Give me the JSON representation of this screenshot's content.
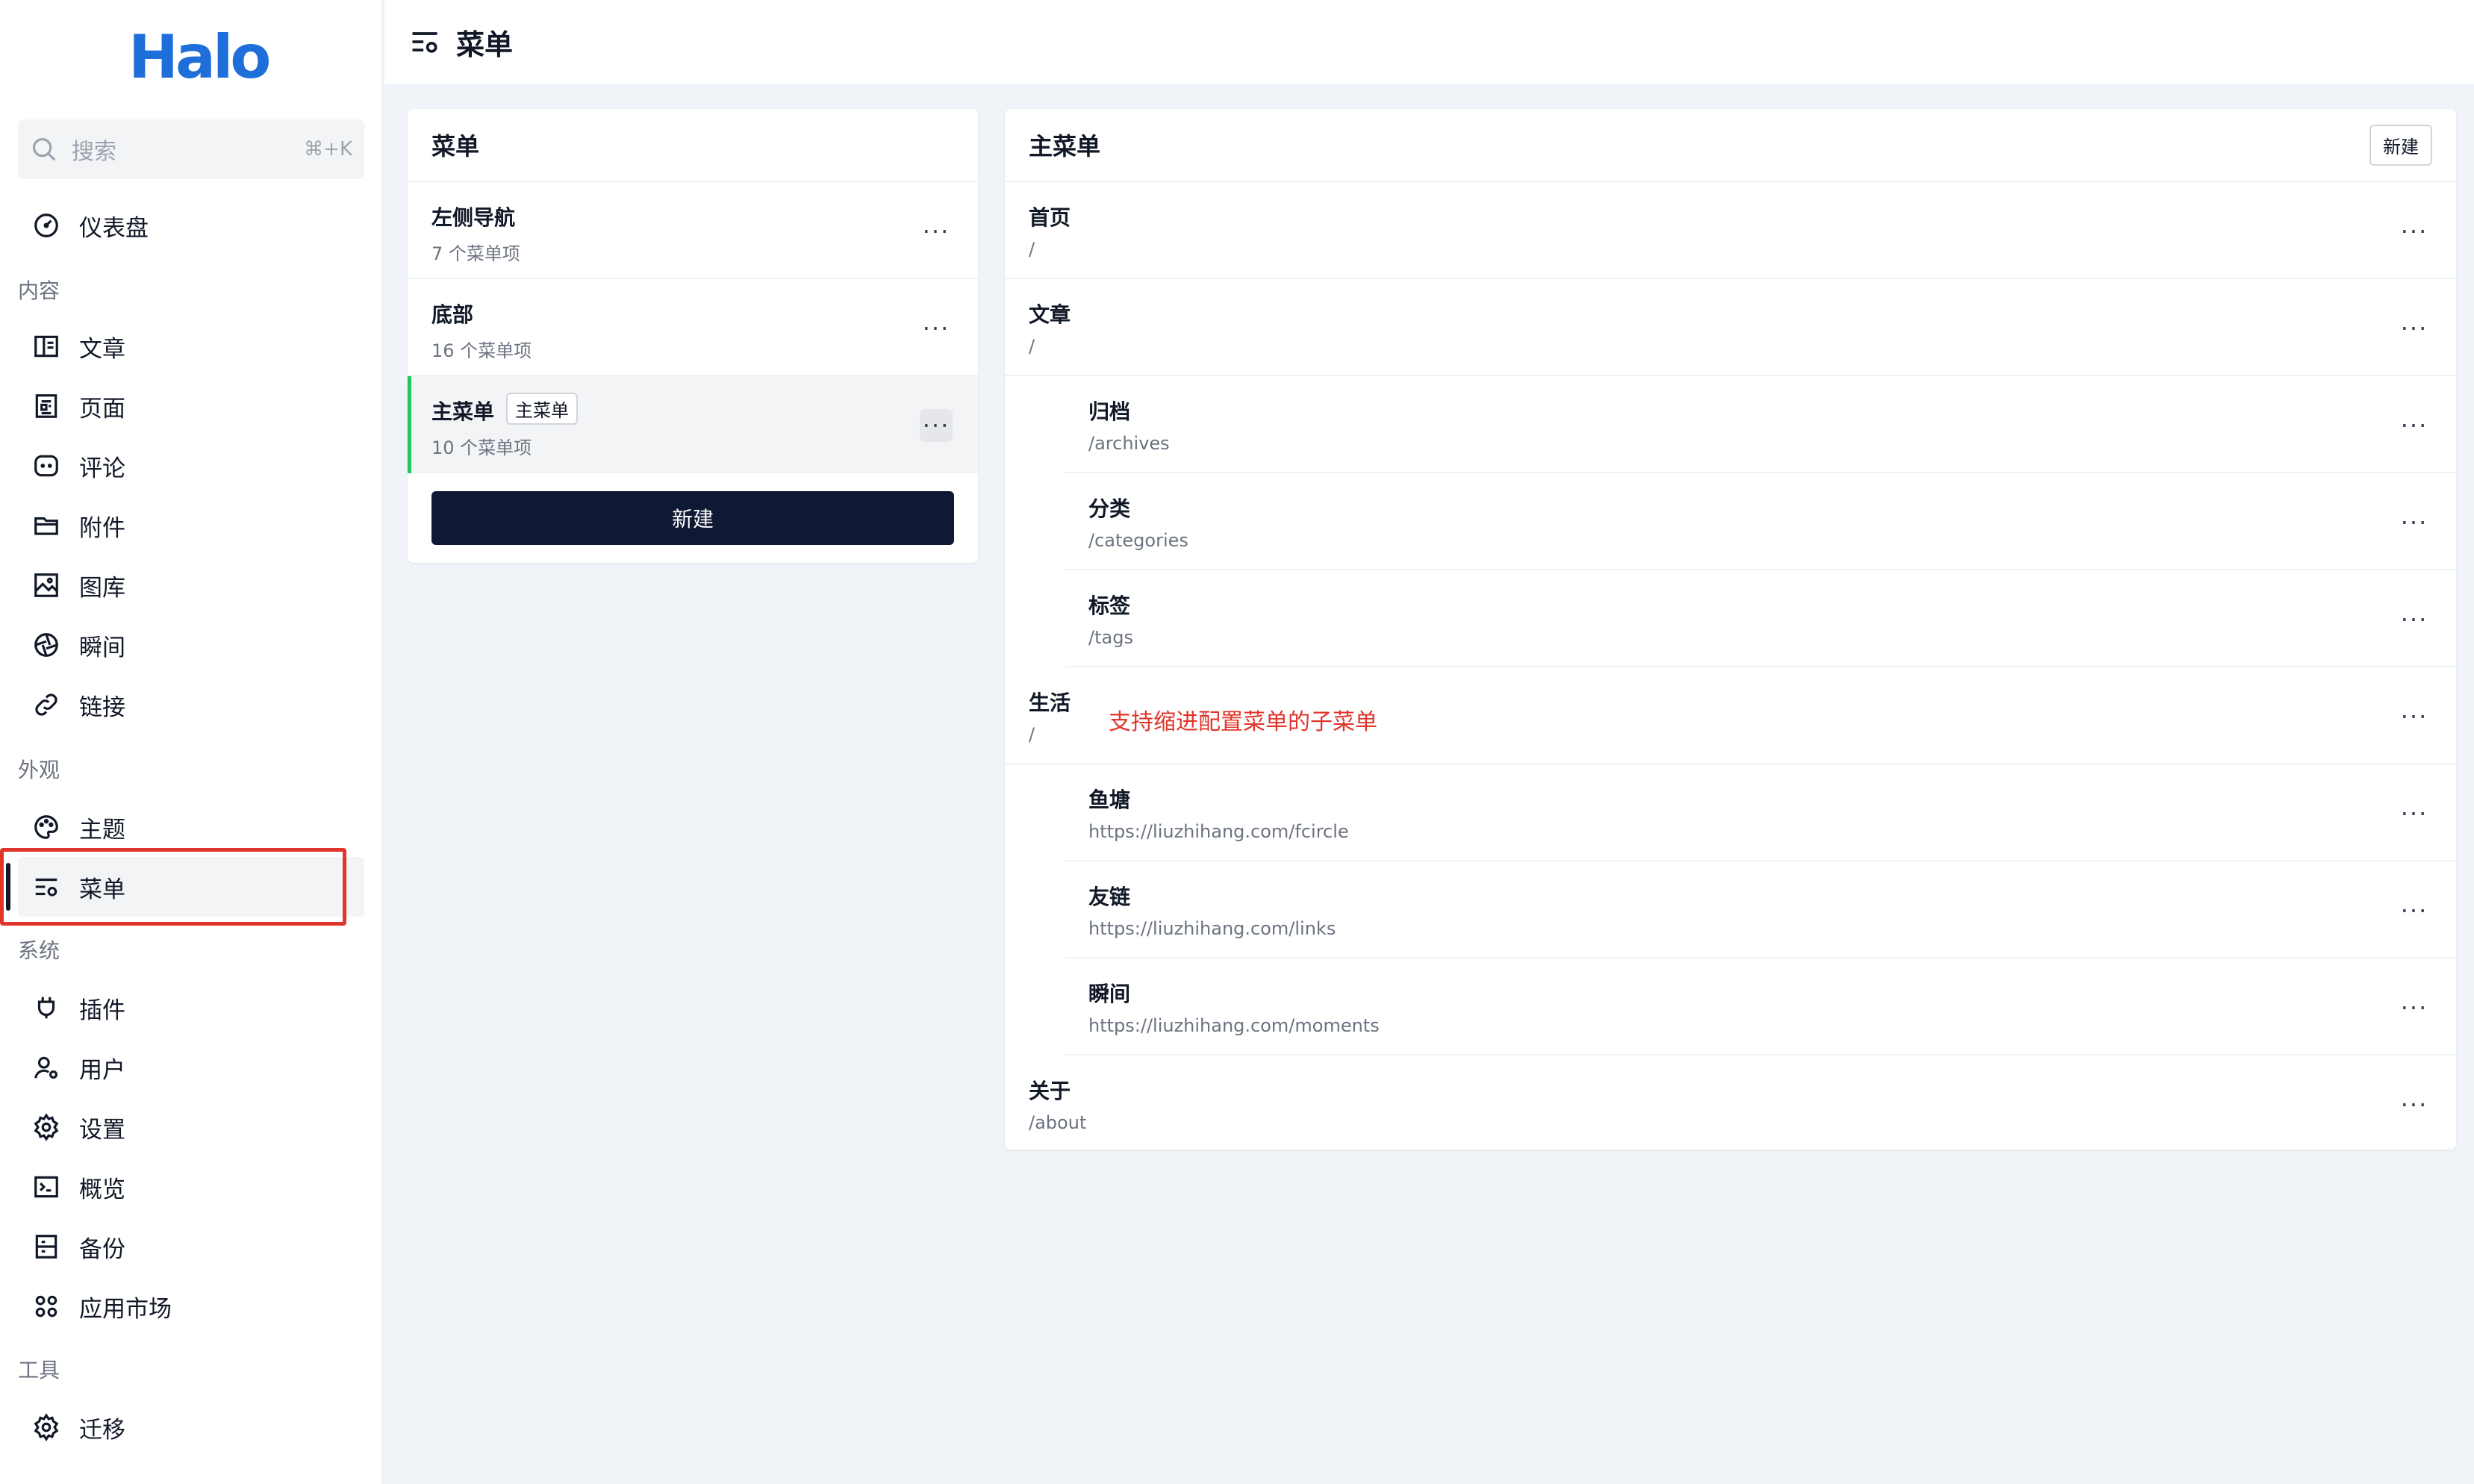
{
  "logo": "Halo",
  "search": {
    "placeholder": "搜索",
    "shortcut": "⌘+K"
  },
  "sidebar": {
    "items": [
      {
        "label": "仪表盘",
        "icon": "dashboard-icon"
      },
      {
        "group": "内容"
      },
      {
        "label": "文章",
        "icon": "book-icon"
      },
      {
        "label": "页面",
        "icon": "page-icon"
      },
      {
        "label": "评论",
        "icon": "comment-icon"
      },
      {
        "label": "附件",
        "icon": "folder-icon"
      },
      {
        "label": "图库",
        "icon": "image-icon"
      },
      {
        "label": "瞬间",
        "icon": "aperture-icon"
      },
      {
        "label": "链接",
        "icon": "link-icon"
      },
      {
        "group": "外观"
      },
      {
        "label": "主题",
        "icon": "palette-icon"
      },
      {
        "label": "菜单",
        "icon": "menu-settings-icon",
        "active": true
      },
      {
        "group": "系统"
      },
      {
        "label": "插件",
        "icon": "plug-icon"
      },
      {
        "label": "用户",
        "icon": "user-settings-icon"
      },
      {
        "label": "设置",
        "icon": "gear-icon"
      },
      {
        "label": "概览",
        "icon": "terminal-icon"
      },
      {
        "label": "备份",
        "icon": "archive-icon"
      },
      {
        "label": "应用市场",
        "icon": "apps-icon"
      },
      {
        "group": "工具"
      },
      {
        "label": "迁移",
        "icon": "migrate-icon"
      }
    ]
  },
  "header": {
    "title": "菜单"
  },
  "menus_panel": {
    "title": "菜单",
    "items": [
      {
        "name": "左侧导航",
        "count": "7 个菜单项"
      },
      {
        "name": "底部",
        "count": "16 个菜单项"
      },
      {
        "name": "主菜单",
        "badge": "主菜单",
        "count": "10 个菜单项",
        "selected": true
      }
    ],
    "new_label": "新建"
  },
  "menu_items_panel": {
    "title": "主菜单",
    "new_label": "新建",
    "items": [
      {
        "name": "首页",
        "path": "/",
        "level": 0
      },
      {
        "name": "文章",
        "path": "/",
        "level": 0
      },
      {
        "name": "归档",
        "path": "/archives",
        "level": 1
      },
      {
        "name": "分类",
        "path": "/categories",
        "level": 1
      },
      {
        "name": "标签",
        "path": "/tags",
        "level": 1
      },
      {
        "name": "生活",
        "path": "/",
        "level": 0
      },
      {
        "name": "鱼塘",
        "path": "https://liuzhihang.com/fcircle",
        "level": 1
      },
      {
        "name": "友链",
        "path": "https://liuzhihang.com/links",
        "level": 1
      },
      {
        "name": "瞬间",
        "path": "https://liuzhihang.com/moments",
        "level": 1
      },
      {
        "name": "关于",
        "path": "/about",
        "level": 0
      }
    ]
  },
  "annotation": "支持缩进配置菜单的子菜单",
  "more_glyph": "···",
  "colors": {
    "accent": "#1e6fd9",
    "primary_button": "#0f1933",
    "annotation": "#e0352b",
    "selected_bar": "#22c55e"
  }
}
